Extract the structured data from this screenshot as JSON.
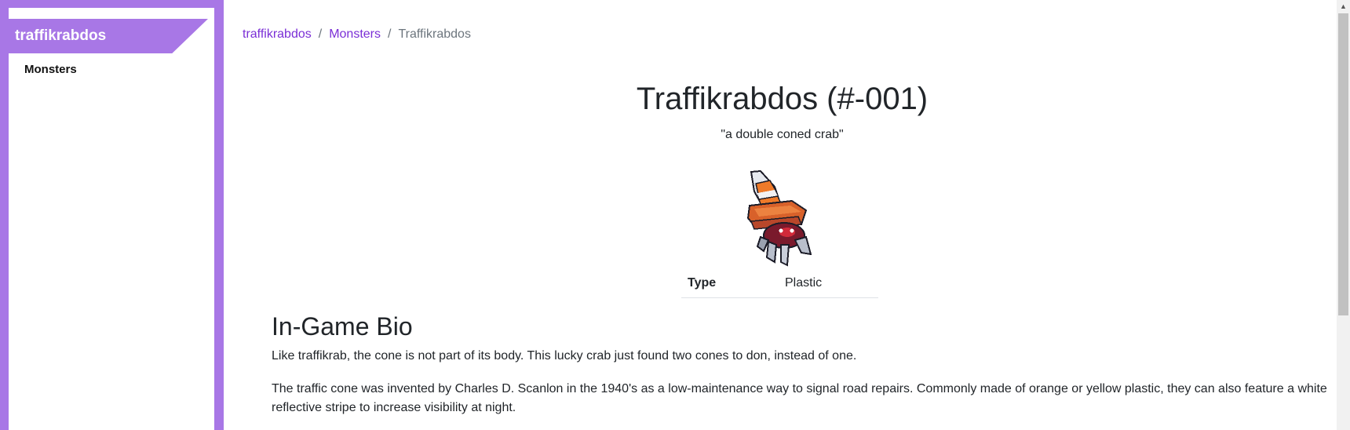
{
  "sidebar": {
    "brand": "traffikrabdos",
    "items": [
      {
        "label": "Monsters"
      }
    ]
  },
  "breadcrumb": {
    "items": [
      {
        "label": "traffikrabdos"
      },
      {
        "label": "Monsters"
      },
      {
        "label": "Traffikrabdos"
      }
    ],
    "separator": "/"
  },
  "monster": {
    "title": "Traffikrabdos (#-001)",
    "tagline": "\"a double coned crab\"",
    "type_label": "Type",
    "type_value": "Plastic"
  },
  "bio": {
    "heading": "In-Game Bio",
    "p1": "Like traffikrab, the cone is not part of its body. This lucky crab just found two cones to don, instead of one.",
    "p2": "The traffic cone was invented by Charles D. Scanlon in the 1940's as a low-maintenance way to signal road repairs. Commonly made of orange or yellow plastic, they can also feature a white reflective stripe to increase visibility at night."
  },
  "colors": {
    "accent": "#a877e6",
    "link": "#7b2fd6"
  },
  "icons": {
    "scroll_up": "▲"
  }
}
